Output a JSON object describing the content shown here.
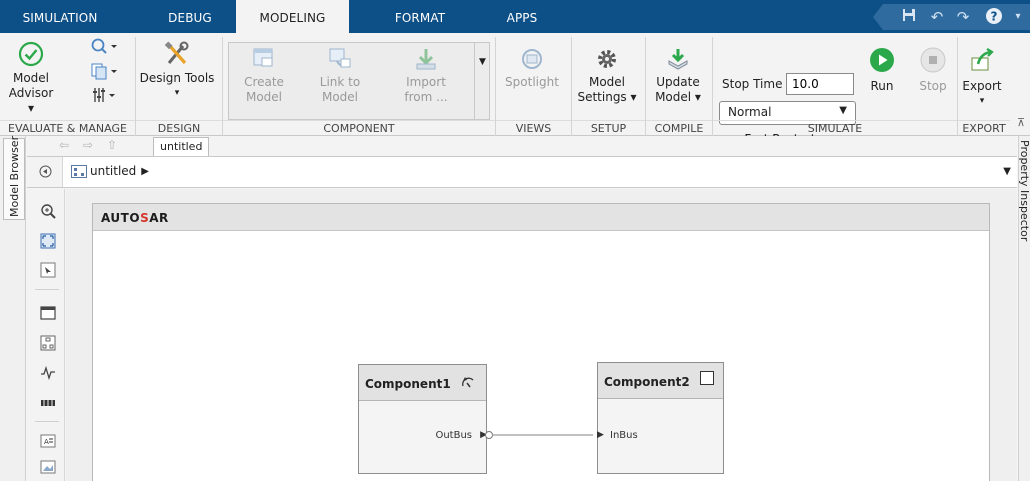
{
  "tabs": [
    "SIMULATION",
    "DEBUG",
    "MODELING",
    "FORMAT",
    "APPS"
  ],
  "active_tab": "MODELING",
  "ribbon": {
    "evaluate": {
      "model_advisor": [
        "Model",
        "Advisor ▾"
      ],
      "section": "EVALUATE & MANAGE"
    },
    "design": {
      "design_tools": "Design Tools",
      "section": "DESIGN"
    },
    "component": {
      "create_model": [
        "Create",
        "Model"
      ],
      "link_to_model": [
        "Link to",
        "Model"
      ],
      "import_from": [
        "Import",
        "from ..."
      ],
      "section": "COMPONENT"
    },
    "views": {
      "spotlight": "Spotlight",
      "section": "VIEWS"
    },
    "setup": {
      "model_settings": [
        "Model",
        "Settings ▾"
      ],
      "section": "SETUP"
    },
    "compile": {
      "update_model": [
        "Update",
        "Model ▾"
      ],
      "section": "COMPILE"
    },
    "simulate": {
      "stop_time_label": "Stop Time",
      "stop_time_value": "10.0",
      "mode": "Normal",
      "fast_restart": "Fast Restart",
      "run": "Run",
      "stop": "Stop",
      "section": "SIMULATE"
    },
    "export": {
      "export": "Export",
      "section": "EXPORT"
    }
  },
  "side_panels": {
    "left": "Model Browser",
    "right": "Property Inspector"
  },
  "editor": {
    "doc_tab": "untitled",
    "breadcrumb": "untitled",
    "frame_logo": "AUTOSAR",
    "blocks": [
      {
        "name": "Component1",
        "port": "OutBus"
      },
      {
        "name": "Component2",
        "port": "InBus"
      }
    ]
  },
  "colors": {
    "tabbar": "#0d4f87",
    "accent_green": "#2ba84a",
    "autosar_red": "#d4362b"
  }
}
